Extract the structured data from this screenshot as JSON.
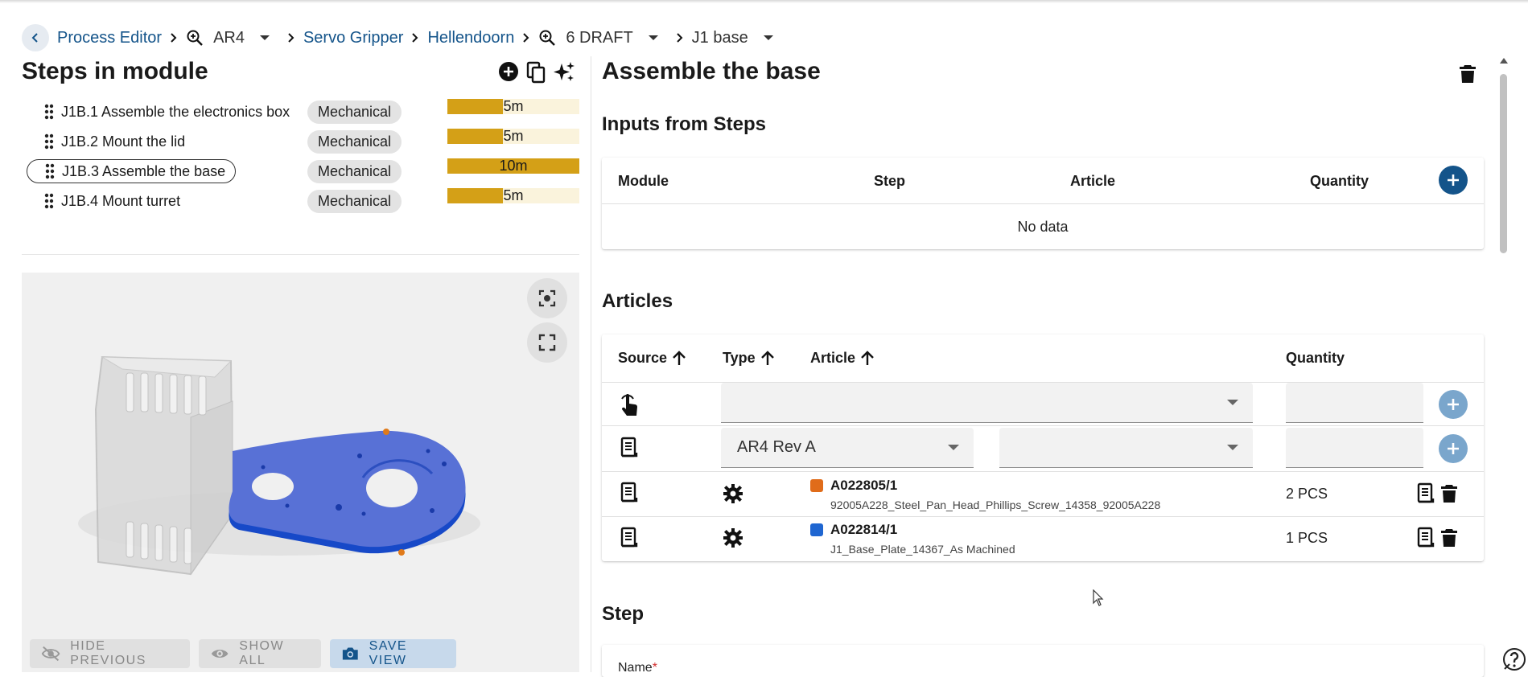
{
  "breadcrumb": {
    "project": "Process Editor",
    "variant": "AR4",
    "product": "Servo Gripper",
    "site": "Hellendoorn",
    "version": "6 DRAFT",
    "module": "J1 base"
  },
  "steps_panel": {
    "title": "Steps in module",
    "steps": [
      {
        "label": "J1B.1 Assemble the electronics box",
        "category": "Mechanical",
        "duration": "5m",
        "fill_fraction": 0.42
      },
      {
        "label": "J1B.2 Mount the lid",
        "category": "Mechanical",
        "duration": "5m",
        "fill_fraction": 0.42
      },
      {
        "label": "J1B.3 Assemble the base",
        "category": "Mechanical",
        "duration": "10m",
        "fill_fraction": 1.0
      },
      {
        "label": "J1B.4 Mount turret",
        "category": "Mechanical",
        "duration": "5m",
        "fill_fraction": 0.42
      }
    ],
    "active_index": 2
  },
  "viewer": {
    "hide_previous": "HIDE PREVIOUS",
    "show_all": "SHOW ALL",
    "save_view": "SAVE VIEW"
  },
  "detail": {
    "title": "Assemble the base",
    "inputs": {
      "title": "Inputs from Steps",
      "headers": {
        "module": "Module",
        "step": "Step",
        "article": "Article",
        "quantity": "Quantity"
      },
      "empty": "No data"
    },
    "articles": {
      "title": "Articles",
      "headers": {
        "source": "Source",
        "type": "Type",
        "article": "Article",
        "quantity": "Quantity"
      },
      "variant_select": "AR4 Rev A",
      "rows": [
        {
          "code": "A022805/1",
          "description": "92005A228_Steel_Pan_Head_Phillips_Screw_14358_92005A228",
          "quantity": "2 PCS",
          "color": "#e06c1a"
        },
        {
          "code": "A022814/1",
          "description": "J1_Base_Plate_14367_As Machined",
          "quantity": "1 PCS",
          "color": "#1f66d1"
        }
      ]
    },
    "step": {
      "title": "Step",
      "name_label": "Name",
      "required_mark": "*"
    }
  },
  "colors": {
    "primary": "#14548a",
    "duration_bar": "#d4a017",
    "duration_track": "#faf3dc"
  }
}
